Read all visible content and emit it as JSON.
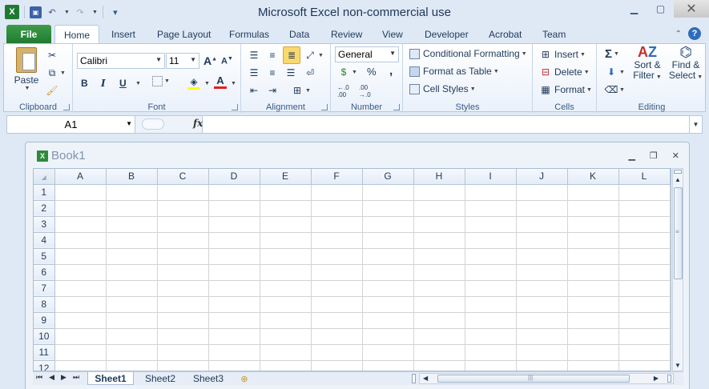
{
  "title": "Microsoft Excel non-commercial use",
  "tabs": {
    "file": "File",
    "items": [
      "Home",
      "Insert",
      "Page Layout",
      "Formulas",
      "Data",
      "Review",
      "View",
      "Developer",
      "Acrobat",
      "Team"
    ]
  },
  "ribbon": {
    "clipboard": {
      "label": "Clipboard",
      "paste": "Paste"
    },
    "font": {
      "label": "Font",
      "name": "Calibri",
      "size": "11",
      "bold": "B",
      "italic": "I",
      "underline": "U"
    },
    "alignment": {
      "label": "Alignment"
    },
    "number": {
      "label": "Number",
      "format": "General",
      "percent": "%",
      "comma": ","
    },
    "styles": {
      "label": "Styles",
      "conditional": "Conditional Formatting",
      "table": "Format as Table",
      "cell": "Cell Styles"
    },
    "cells": {
      "label": "Cells",
      "insert": "Insert",
      "delete": "Delete",
      "format": "Format"
    },
    "editing": {
      "label": "Editing",
      "sort": "Sort &",
      "sort2": "Filter",
      "find": "Find &",
      "find2": "Select",
      "sigma": "Σ"
    }
  },
  "formula_bar": {
    "name_box": "A1",
    "fx": "fx",
    "value": ""
  },
  "workbook": {
    "title": "Book1",
    "columns": [
      "A",
      "B",
      "C",
      "D",
      "E",
      "F",
      "G",
      "H",
      "I",
      "J",
      "K",
      "L"
    ],
    "rows": [
      "1",
      "2",
      "3",
      "4",
      "5",
      "6",
      "7",
      "8",
      "9",
      "10",
      "11",
      "12"
    ],
    "sheets": [
      "Sheet1",
      "Sheet2",
      "Sheet3"
    ]
  },
  "colors": {
    "file_tab": "#1e7a31",
    "accent": "#2f6cbf",
    "fill_highlight": "#ffff00",
    "font_color": "#e02020"
  },
  "icons": [
    "excel-icon",
    "save-icon",
    "undo-icon",
    "redo-icon",
    "help-icon",
    "paste-icon",
    "cut-icon",
    "copy-icon",
    "format-painter-icon"
  ]
}
